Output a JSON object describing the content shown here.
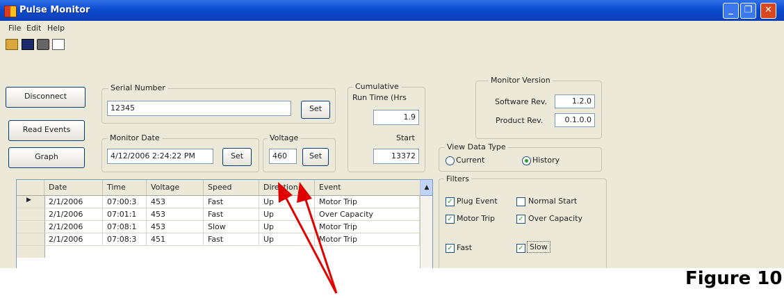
{
  "window": {
    "title": "Pulse Monitor"
  },
  "menu": [
    "File",
    "Edit",
    "Help"
  ],
  "buttons": {
    "disconnect": "Disconnect",
    "read_events": "Read Events",
    "graph": "Graph",
    "set": "Set"
  },
  "serial": {
    "label": "Serial Number",
    "value": "12345"
  },
  "monitor_date": {
    "label": "Monitor Date",
    "value": "4/12/2006 2:24:22 PM"
  },
  "voltage": {
    "label": "Voltage",
    "value": "460"
  },
  "cumulative": {
    "label": "Cumulative",
    "runtime_label": "Run Time (Hrs",
    "runtime_value": "1.9",
    "start_label": "Start",
    "start_value": "13372"
  },
  "monitor_version": {
    "label": "Monitor Version",
    "software_label": "Software Rev.",
    "software_value": "1.2.0",
    "product_label": "Product Rev.",
    "product_value": "0.1.0.0"
  },
  "view_type": {
    "label": "View Data Type",
    "current": "Current",
    "history": "History",
    "selected": "History"
  },
  "filters": {
    "label": "Filters",
    "plug_event": "Plug Event",
    "normal_start": "Normal Start",
    "motor_trip": "Motor Trip",
    "over_capacity": "Over Capacity",
    "fast": "Fast",
    "slow": "Slow"
  },
  "grid": {
    "columns": [
      "Date",
      "Time",
      "Voltage",
      "Speed",
      "Direction",
      "Event"
    ],
    "rows": [
      [
        "2/1/2006",
        "07:00:3",
        "453",
        "Fast",
        "Up",
        "Motor Trip"
      ],
      [
        "2/1/2006",
        "07:01:1",
        "453",
        "Fast",
        "Up",
        "Over Capacity"
      ],
      [
        "2/1/2006",
        "07:08:1",
        "453",
        "Slow",
        "Up",
        "Motor Trip"
      ],
      [
        "2/1/2006",
        "07:08:3",
        "451",
        "Fast",
        "Up",
        "Motor Trip"
      ]
    ]
  },
  "figure_label": "Figure 10",
  "colors": {
    "annotation_arrow": "#e00000"
  }
}
